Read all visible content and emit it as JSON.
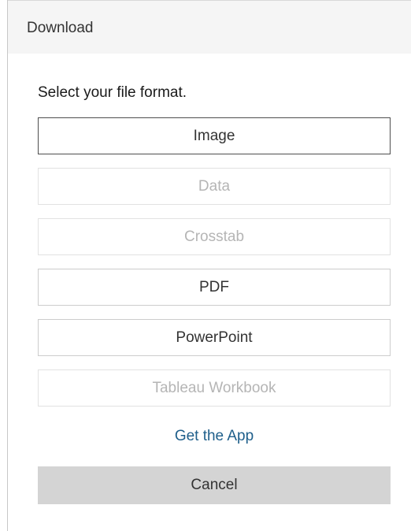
{
  "dialog": {
    "title": "Download",
    "prompt": "Select your file format."
  },
  "formats": [
    {
      "label": "Image",
      "state": "selected"
    },
    {
      "label": "Data",
      "state": "disabled"
    },
    {
      "label": "Crosstab",
      "state": "disabled"
    },
    {
      "label": "PDF",
      "state": "enabled"
    },
    {
      "label": "PowerPoint",
      "state": "enabled"
    },
    {
      "label": "Tableau Workbook",
      "state": "disabled"
    }
  ],
  "links": {
    "get_app": "Get the App"
  },
  "actions": {
    "cancel": "Cancel"
  },
  "colors": {
    "link": "#1f5f8b",
    "header_bg": "#f5f5f5",
    "cancel_bg": "#d4d4d4",
    "disabled_text": "#b5b5b5"
  }
}
